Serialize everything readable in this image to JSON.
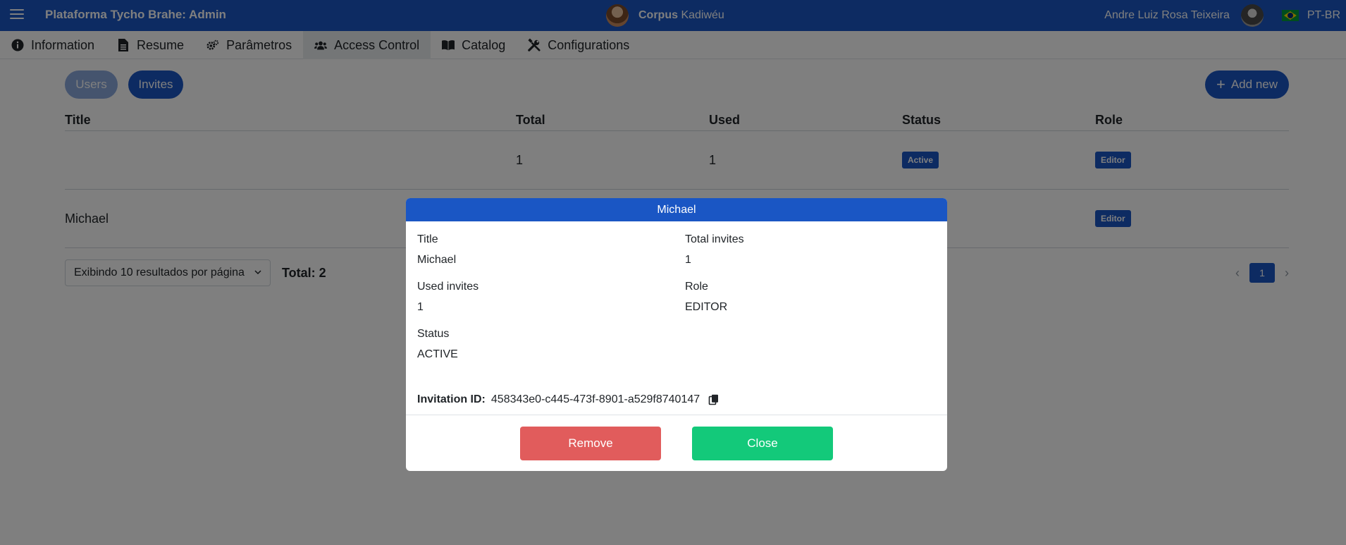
{
  "header": {
    "app_title": "Plataforma Tycho Brahe: Admin",
    "corpus_label": "Corpus",
    "corpus_name": "Kadiwéu",
    "user_name": "Andre Luiz Rosa Teixeira",
    "language": "PT-BR"
  },
  "tabs": [
    {
      "label": "Information",
      "icon": "info-icon"
    },
    {
      "label": "Resume",
      "icon": "document-icon"
    },
    {
      "label": "Parâmetros",
      "icon": "gears-icon"
    },
    {
      "label": "Access Control",
      "icon": "users-icon",
      "active": true
    },
    {
      "label": "Catalog",
      "icon": "book-icon"
    },
    {
      "label": "Configurations",
      "icon": "tools-icon"
    }
  ],
  "toolbar": {
    "users_label": "Users",
    "invites_label": "Invites",
    "add_new_label": "Add new"
  },
  "table": {
    "columns": [
      "Title",
      "Total",
      "Used",
      "Status",
      "Role"
    ],
    "rows": [
      {
        "title": "",
        "total": "1",
        "used": "1",
        "status": "Active",
        "role": "Editor"
      },
      {
        "title": "Michael",
        "total": "",
        "used": "",
        "status": "",
        "role": "Editor"
      }
    ]
  },
  "footer": {
    "page_size_label": "Exibindo 10 resultados por página",
    "total_label": "Total: 2",
    "current_page": "1"
  },
  "modal": {
    "title": "Michael",
    "fields": {
      "title_label": "Title",
      "title_value": "Michael",
      "total_label": "Total invites",
      "total_value": "1",
      "used_label": "Used invites",
      "used_value": "1",
      "role_label": "Role",
      "role_value": "EDITOR",
      "status_label": "Status",
      "status_value": "ACTIVE"
    },
    "invitation_label": "Invitation ID:",
    "invitation_id": "458343e0-c445-473f-8901-a529f8740147",
    "remove_label": "Remove",
    "close_label": "Close"
  },
  "colors": {
    "primary": "#1a56c4",
    "danger": "#e15c5c",
    "success": "#13c97a"
  }
}
